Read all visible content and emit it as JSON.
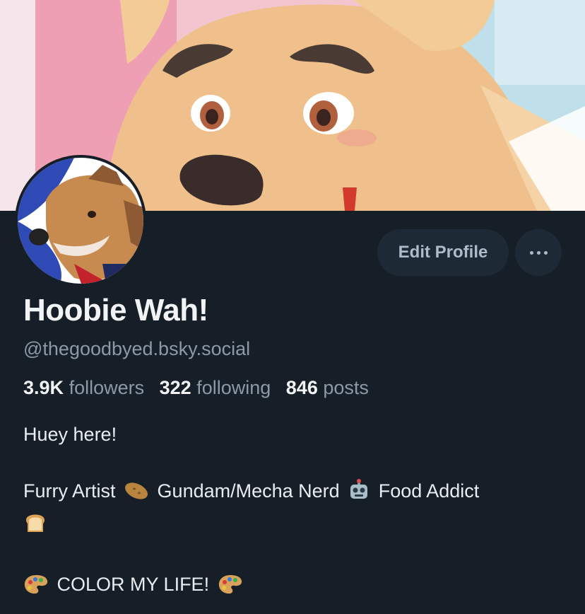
{
  "profile": {
    "display_name": "Hoobie Wah!",
    "handle": "@thegoodbyed.bsky.social",
    "stats": {
      "followers_count": "3.9K",
      "followers_label": "followers",
      "following_count": "322",
      "following_label": "following",
      "posts_count": "846",
      "posts_label": "posts"
    },
    "bio": {
      "line1": "Huey here!",
      "line2_part1": "Furry Artist",
      "line2_part2": "Gundam/Mecha Nerd",
      "line2_part3": "Food Addict",
      "line3": "COLOR MY LIFE!"
    }
  },
  "actions": {
    "edit_profile_label": "Edit Profile"
  },
  "icons": {
    "more": "more-horizontal-icon",
    "emoji_potato": "potato-emoji",
    "emoji_robot": "robot-emoji",
    "emoji_bread": "bread-emoji",
    "emoji_palette": "palette-emoji"
  },
  "colors": {
    "background": "#161e27",
    "button_bg": "#1e2936",
    "muted_text": "#8c99a8",
    "button_text": "#aebbc9"
  }
}
